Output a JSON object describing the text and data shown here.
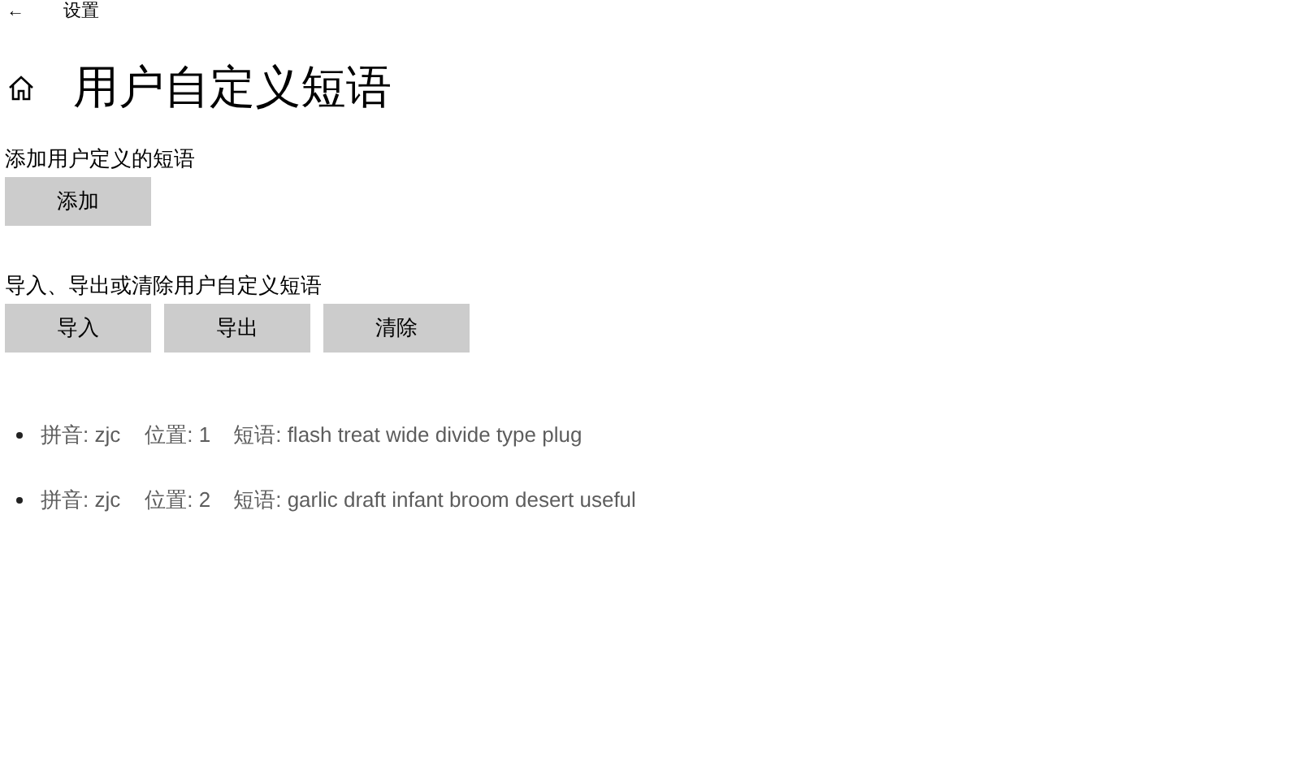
{
  "header": {
    "back": "←",
    "title": "设置"
  },
  "page_title": "用户自定义短语",
  "sections": [
    {
      "label": "添加用户定义的短语",
      "buttons": [
        "添加"
      ]
    },
    {
      "label": "导入、导出或清除用户自定义短语",
      "buttons": [
        "导入",
        "导出",
        "清除"
      ]
    }
  ],
  "phrases": [
    {
      "pinyin": "拼音: zjc",
      "position": "位置: 1",
      "phrase": "短语: flash treat wide divide type plug"
    },
    {
      "pinyin": "拼音: zjc",
      "position": "位置: 2",
      "phrase": "短语: garlic draft infant broom desert useful"
    }
  ]
}
